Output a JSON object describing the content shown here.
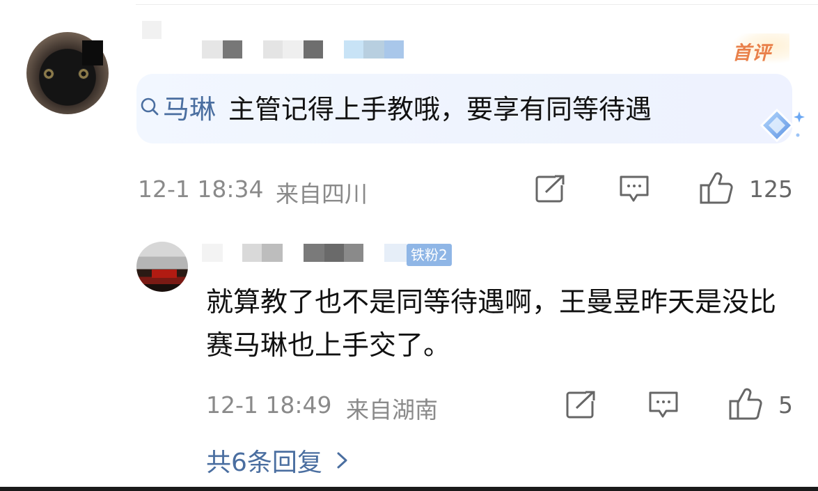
{
  "comment": {
    "first_comment_badge": "首评",
    "mention": "马琳",
    "body": "主管记得上手教哦，要享有同等待遇",
    "date": "12-1 18:34",
    "location": "来自四川",
    "like_count": "125",
    "icons": [
      "share-icon",
      "reply-icon",
      "like-icon"
    ]
  },
  "reply": {
    "fan_badge": "铁粉2",
    "body": "就算教了也不是同等待遇啊，王曼昱昨天是没比赛马琳也上手交了。",
    "date": "12-1 18:49",
    "location": "来自湖南",
    "like_count": "5"
  },
  "more_replies": "共6条回复",
  "colors": {
    "link": "#4a6ea0",
    "meta": "#8a8a8a",
    "first_badge": "#e9804a",
    "fan_badge": "#8fb6e6"
  }
}
